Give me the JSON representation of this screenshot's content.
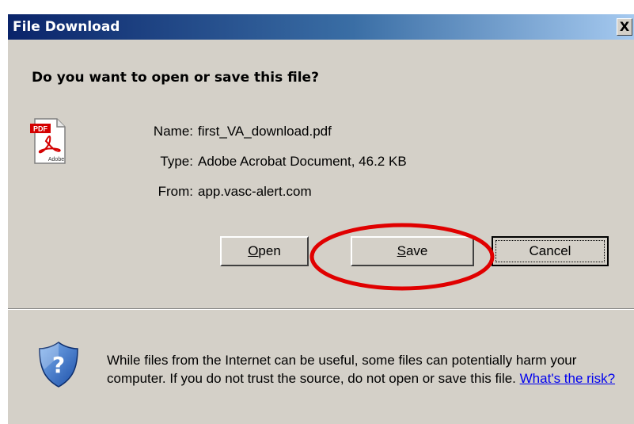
{
  "window": {
    "title": "File Download",
    "close_glyph": "X"
  },
  "dialog": {
    "question": "Do you want to open or save this file?",
    "file_icon": "pdf-file-icon",
    "file_icon_text": "PDF",
    "file_icon_brand": "Adobe",
    "fields": [
      {
        "label": "Name:",
        "value": "first_VA_download.pdf"
      },
      {
        "label": "Type:",
        "value": "Adobe Acrobat Document, 46.2 KB"
      },
      {
        "label": "From:",
        "value": "app.vasc-alert.com"
      }
    ],
    "buttons": {
      "open_accel": "O",
      "open_rest": "pen",
      "save_accel": "S",
      "save_rest": "ave",
      "cancel": "Cancel"
    },
    "highlight_color": "#e00000"
  },
  "warning": {
    "icon": "shield-question-icon",
    "text": "While files from the Internet can be useful, some files can potentially harm your computer. If you do not trust the source, do not open or save this file. ",
    "link": "What's the risk?"
  },
  "colors": {
    "title_bar_start": "#0a246a",
    "title_bar_end": "#a6caf0",
    "dialog_bg": "#d4d0c8"
  }
}
